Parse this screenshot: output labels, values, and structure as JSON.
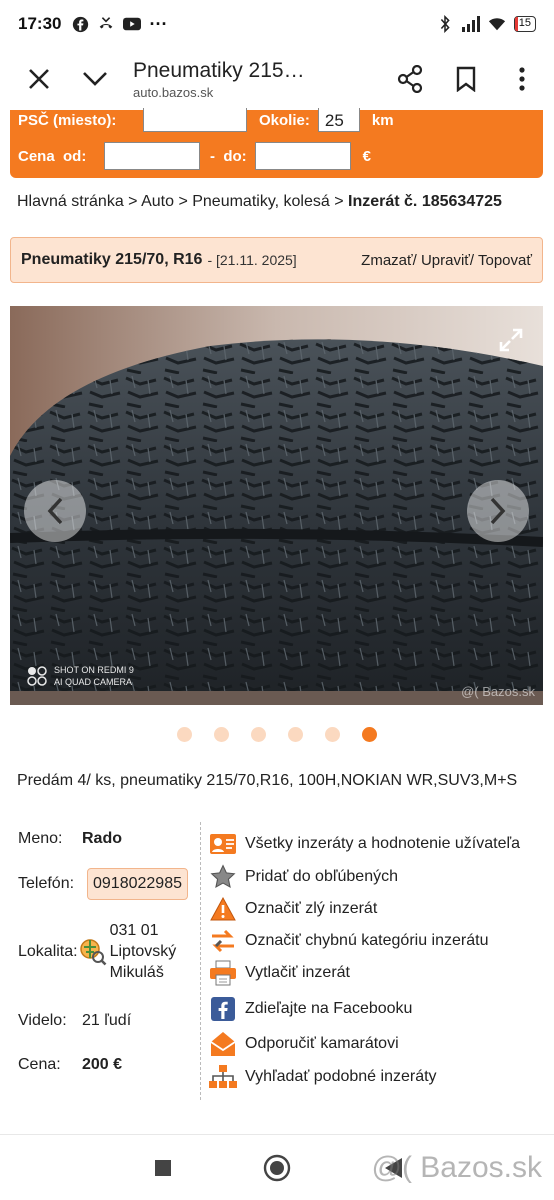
{
  "status": {
    "time": "17:30",
    "battery": "15"
  },
  "browser": {
    "title": "Pneumatiky 215…",
    "domain": "auto.bazos.sk"
  },
  "search": {
    "psc_label": "PSČ (miesto):",
    "okolie_label": "Okolie:",
    "okolie_value": "25",
    "km": "km",
    "cena_label": "Cena  od:",
    "do_label": "-  do:",
    "euro": "€"
  },
  "breadcrumb": {
    "home": "Hlavná stránka",
    "sep": " > ",
    "auto": "Auto",
    "cat": "Pneumatiky, kolesá",
    "ad": "Inzerát č. 185634725"
  },
  "ad": {
    "title": "Pneumatiky 215/70, R16",
    "date": "- [21.11. 2025]",
    "actions": "Zmazať/ Upraviť/ Topovať",
    "photo_watermark_1": "SHOT ON REDMI 9",
    "photo_watermark_2": "AI QUAD CAMERA",
    "photo_site": "@( Bazos.sk",
    "photo_count": 6,
    "active_photo": 6,
    "description": "Predám 4/ ks, pneumatiky 215/70,R16, 100H,NOKIAN WR,SUV3,M+S"
  },
  "info": {
    "meno_label": "Meno:",
    "meno": "Rado",
    "telefon_label": "Telefón:",
    "telefon": "0918022985",
    "lokalita_label": "Lokalita:",
    "lokalita_1": "031 01",
    "lokalita_2": "Liptovský",
    "lokalita_3": "Mikuláš",
    "videlo_label": "Videlo:",
    "videlo": "21 ľudí",
    "cena_label": "Cena:",
    "cena": "200 €"
  },
  "actions": [
    {
      "label": "Všetky inzeráty a hodnotenie užívateľa",
      "icon": "user-card-icon"
    },
    {
      "label": "Pridať do obľúbených",
      "icon": "star-icon"
    },
    {
      "label": "Označiť zlý inzerát",
      "icon": "warning-icon"
    },
    {
      "label": "Označiť chybnú kategóriu inzerátu",
      "icon": "swap-arrows-icon"
    },
    {
      "label": "Vytlačiť inzerát",
      "icon": "printer-icon"
    },
    {
      "label": "Zdieľajte na Facebooku",
      "icon": "facebook-icon"
    },
    {
      "label": "Odporučiť kamarátovi",
      "icon": "envelope-icon"
    },
    {
      "label": "Vyhľadať podobné inzeráty",
      "icon": "sitemap-icon"
    }
  ],
  "footer": {
    "watermark": "@( Bazos.sk"
  },
  "colors": {
    "accent": "#f47a20",
    "light": "#fde4d2"
  }
}
